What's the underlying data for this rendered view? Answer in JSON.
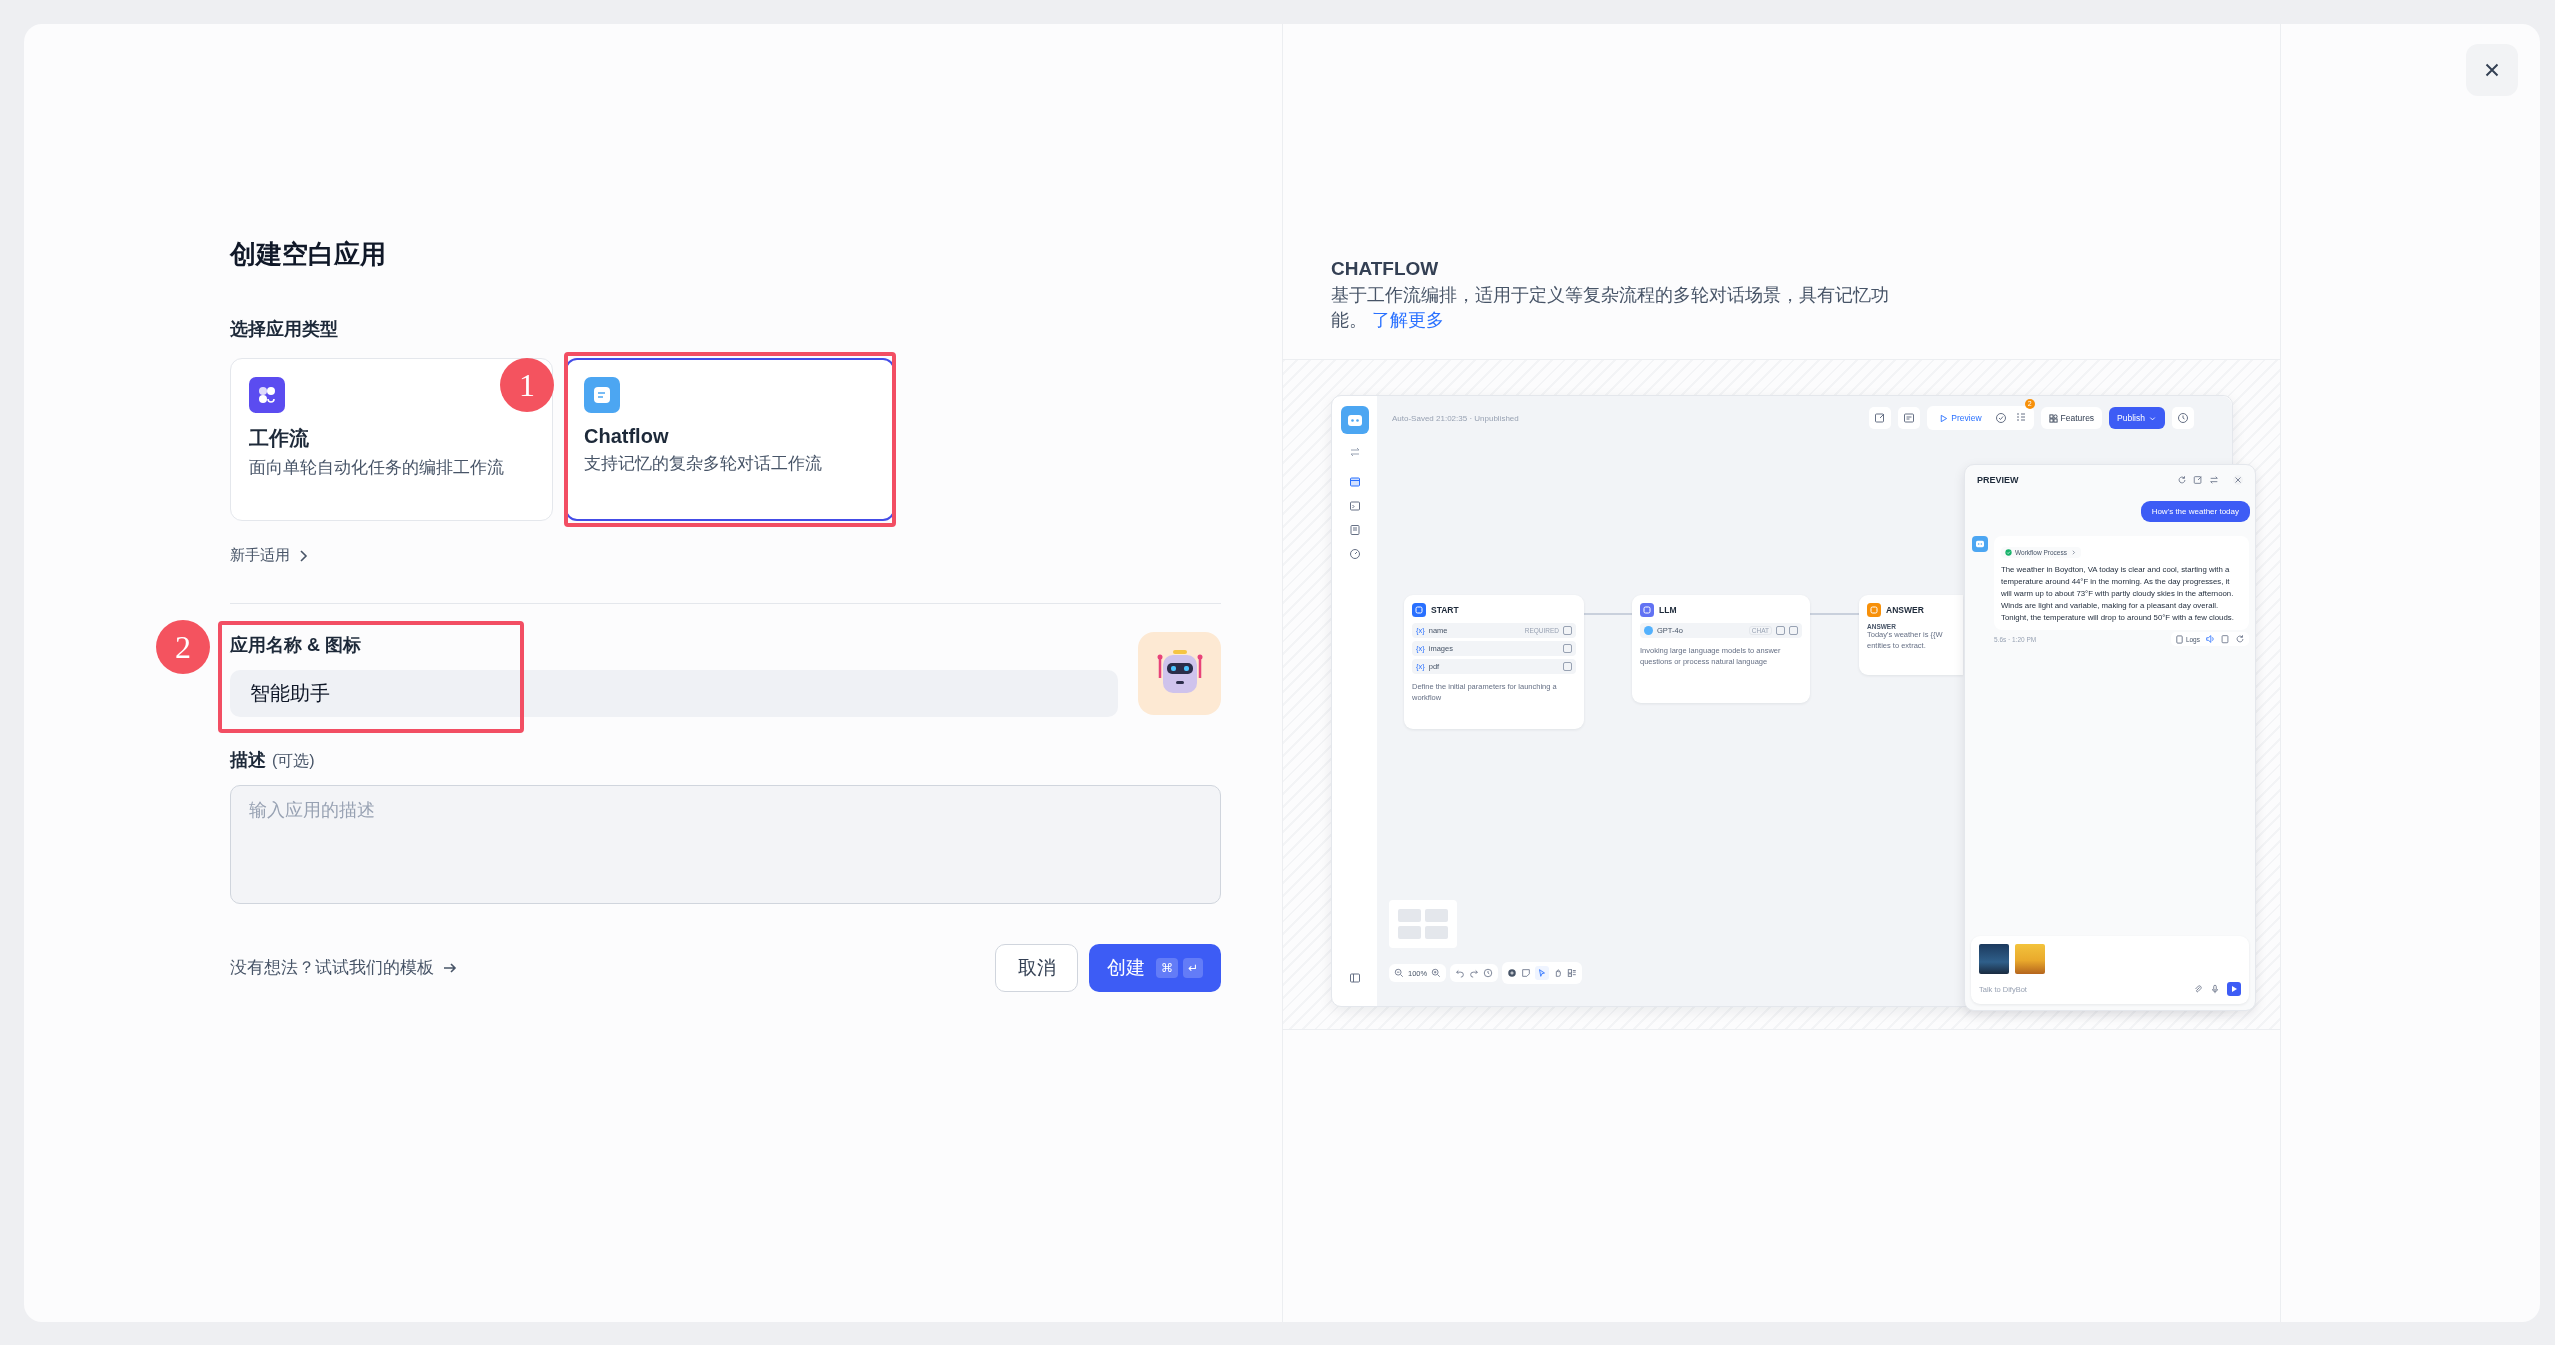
{
  "title": "创建空白应用",
  "app_type": {
    "label": "选择应用类型",
    "options": [
      {
        "kind": "workflow",
        "name": "工作流",
        "description": "面向单轮自动化任务的编排工作流",
        "selected": false
      },
      {
        "kind": "chatflow",
        "name": "Chatflow",
        "description": "支持记忆的复杂多轮对话工作流",
        "selected": true
      }
    ],
    "beginner_link": "新手适用"
  },
  "name_field": {
    "label": "应用名称 & 图标",
    "value": "智能助手"
  },
  "description_field": {
    "label": "描述",
    "optional": "(可选)",
    "placeholder": "输入应用的描述"
  },
  "template_link": "没有想法？试试我们的模板",
  "buttons": [
    {
      "kind": "cancel",
      "label": "取消"
    },
    {
      "kind": "create",
      "label": "创建",
      "shortcut": [
        "⌘",
        "↵"
      ]
    }
  ],
  "annotations": [
    {
      "label": "1"
    },
    {
      "label": "2"
    }
  ],
  "info": {
    "heading": "CHATFLOW",
    "text": "基于工作流编排，适用于定义等复杂流程的多轮对话场景，具有记忆功能。",
    "link": "了解更多"
  },
  "preview_app": {
    "status": "Auto-Saved 21:02:35 · Unpublished",
    "toolbar_buttons": [
      {
        "kind": "preview",
        "label": "Preview"
      },
      {
        "kind": "features",
        "label": "Features"
      },
      {
        "kind": "publish",
        "label": "Publish"
      }
    ],
    "badge": "2",
    "nodes": [
      {
        "kind": "start",
        "title": "START",
        "variables": [
          {
            "prefix": "{x}",
            "name": "name",
            "tag": "REQUIRED"
          },
          {
            "prefix": "{x}",
            "name": "images"
          },
          {
            "prefix": "{x}",
            "name": "pdf"
          }
        ],
        "description": "Define the initial parameters for launching a workflow"
      },
      {
        "kind": "llm",
        "title": "LLM",
        "model": "GPT-4o",
        "model_tag": "CHAT",
        "description": "Invoking large language models to answer questions or process natural language"
      },
      {
        "kind": "answer",
        "title": "ANSWER",
        "field_label": "ANSWER",
        "lines": [
          "Today's weather is {{W",
          "entities to extract."
        ]
      }
    ],
    "zoom": "100%",
    "chat": {
      "title": "PREVIEW",
      "user_message": "How's the weather today",
      "process": "Workflow Process",
      "answer": "The weather in Boydton, VA today is clear and cool, starting with a temperature around 44°F in the morning. As the day progresses, it will warm up to about 73°F with partly cloudy skies in the afternoon. Winds are light and variable, making for a pleasant day overall. Tonight, the temperature will drop to around 50°F with a few clouds.",
      "meta": "5.6s · 1:20 PM",
      "logs": "Logs",
      "input_placeholder": "Talk to DifyBot"
    }
  }
}
